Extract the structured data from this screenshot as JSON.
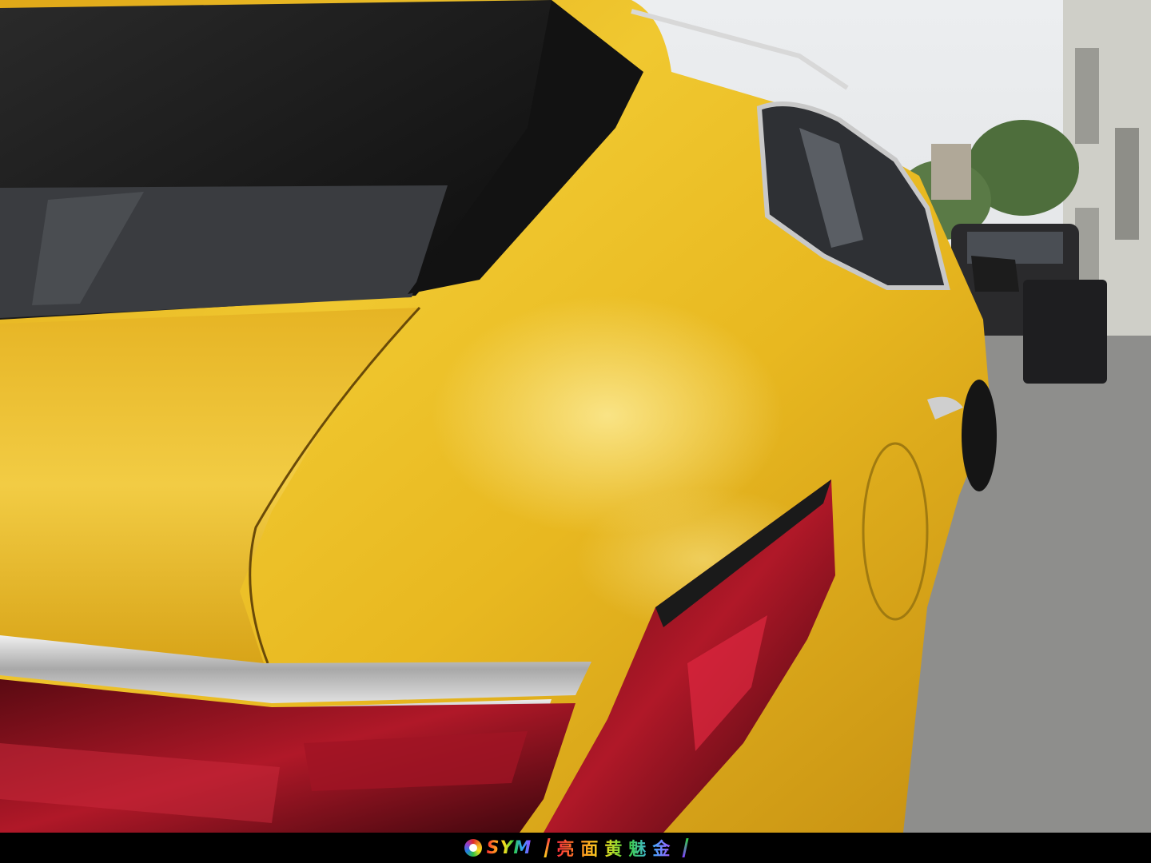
{
  "photo": {
    "subject": "car-rear-quarter",
    "colors": {
      "paint": "#e8b820",
      "paint_shadow": "#b88a10",
      "paint_highlight": "#f6d860",
      "glass": "#141414",
      "taillight": "#8a1020",
      "chrome": "#c8c8c8",
      "sky": "#e2e4e6",
      "pavement": "#8e8e8c",
      "building": "#c8c8c2",
      "trees": "#4a6a3a"
    }
  },
  "caption": {
    "brand_logo": "SYM",
    "text": "亮面黄魅金",
    "bar_color": "#000000"
  }
}
